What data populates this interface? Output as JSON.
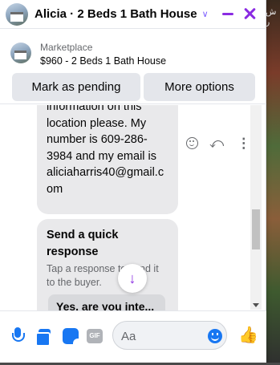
{
  "header": {
    "title": "Alicia · 2 Beds 1 Bath House",
    "chevron": "∨"
  },
  "background": {
    "glyph": "ش ر"
  },
  "marketplace": {
    "label": "Marketplace",
    "item": "$960 - 2 Beds 1 Bath House",
    "mark_pending": "Mark as pending",
    "more_options": "More options"
  },
  "messages": {
    "bubble_lines": [
      "information on this",
      "location please. My",
      "number is 609-286-",
      "3984 and my email is",
      "aliciaharris40@gmail.c",
      "om"
    ],
    "quick_title": "Send a quick response",
    "quick_sub": "Tap a response to send it to the buyer.",
    "quick_option": "Yes, are you inte..."
  },
  "composer": {
    "gif_label": "GIF",
    "placeholder": "Aa"
  },
  "colors": {
    "accent": "#8a2be2",
    "brand_blue": "#1877f2"
  }
}
